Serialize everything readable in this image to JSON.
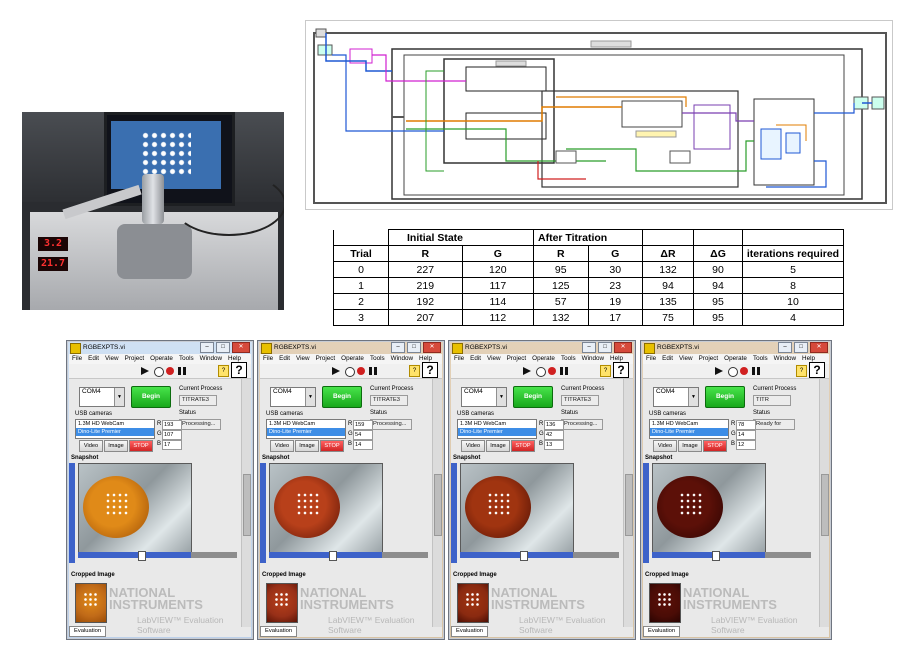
{
  "photo": {
    "led_top": "3.2",
    "led_bottom": "21.7"
  },
  "table": {
    "group_headers": [
      "Initial State",
      "After Titration"
    ],
    "columns": [
      "Trial",
      "R",
      "G",
      "R",
      "G",
      "ΔR",
      "ΔG",
      "iterations required"
    ],
    "rows": [
      [
        "0",
        "227",
        "120",
        "95",
        "30",
        "132",
        "90",
        "5"
      ],
      [
        "1",
        "219",
        "117",
        "125",
        "23",
        "94",
        "94",
        "8"
      ],
      [
        "2",
        "192",
        "114",
        "57",
        "19",
        "135",
        "95",
        "10"
      ],
      [
        "3",
        "207",
        "112",
        "132",
        "17",
        "75",
        "95",
        "4"
      ]
    ]
  },
  "windows": [
    {
      "title": "RGBEXPTS.vi",
      "frame": "aero",
      "process": "TITRATE3",
      "status": "Processing...",
      "R": "193",
      "G": "107",
      "B": "17",
      "drop_color": "#e08a18",
      "drop_dark": "#9a4c06",
      "crop_color": "#c06a18"
    },
    {
      "title": "RGBEXPTS.vi",
      "frame": "tan",
      "process": "TITRATE3",
      "status": "Processing...",
      "R": "159",
      "G": "54",
      "B": "14",
      "drop_color": "#b8401a",
      "drop_dark": "#5c1406",
      "crop_color": "#983018"
    },
    {
      "title": "RGBEXPTS.vi",
      "frame": "tan",
      "process": "TITRATE3",
      "status": "Processing...",
      "R": "136",
      "G": "42",
      "B": "13",
      "drop_color": "#a03410",
      "drop_dark": "#4c0e04",
      "crop_color": "#8a2a10"
    },
    {
      "title": "RGBEXPTS.vi",
      "frame": "tan",
      "process": "TITR",
      "status": "Ready for",
      "R": "78",
      "G": "14",
      "B": "12",
      "drop_color": "#5c1008",
      "drop_dark": "#2a0402",
      "crop_color": "#4a0c06"
    }
  ],
  "common": {
    "menu": [
      "File",
      "Edit",
      "View",
      "Project",
      "Operate",
      "Tools",
      "Window",
      "Help"
    ],
    "com_port": "COM4",
    "begin_label": "Begin",
    "current_process_label": "Current Process",
    "status_label": "Status",
    "usb_label": "USB cameras",
    "cameras": [
      "1.3M HD WebCam",
      "Dino-Lite Premier"
    ],
    "btn_video": "Video",
    "btn_image": "Image",
    "btn_stop": "STOP",
    "snapshot_label": "Snapshot",
    "cropped_label": "Cropped Image",
    "ni_line1": "NATIONAL",
    "ni_line2": "INSTRUMENTS",
    "ni_sub": "LabVIEW™ Evaluation Software",
    "eval_tab": "Evaluation",
    "help_glyph": "?",
    "r_letter": "R",
    "g_letter": "G",
    "b_letter": "B"
  }
}
